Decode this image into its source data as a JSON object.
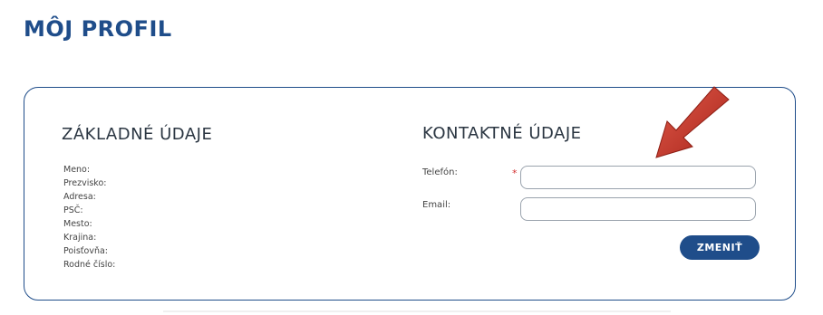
{
  "page": {
    "title": "MÔJ PROFIL"
  },
  "basic": {
    "title": "ZÁKLADNÉ ÚDAJE",
    "rows": [
      {
        "label": "Meno:",
        "value": ""
      },
      {
        "label": "Prezvisko:",
        "value": ""
      },
      {
        "label": "Adresa:",
        "value": ""
      },
      {
        "label": "PSČ:",
        "value": ""
      },
      {
        "label": "Mesto:",
        "value": ""
      },
      {
        "label": "Krajina:",
        "value": ""
      },
      {
        "label": "Poisťovňa:",
        "value": ""
      },
      {
        "label": "Rodné číslo:",
        "value": ""
      }
    ]
  },
  "contact": {
    "title": "KONTAKTNÉ ÚDAJE",
    "phone_label": "Telefón:",
    "required_mark": "*",
    "phone_value": "",
    "email_label": "Email:",
    "email_value": ""
  },
  "actions": {
    "change_label": "ZMENIŤ"
  },
  "colors": {
    "brand": "#1f4d8a",
    "required": "#d32f2f",
    "arrow": "#c0392b"
  }
}
